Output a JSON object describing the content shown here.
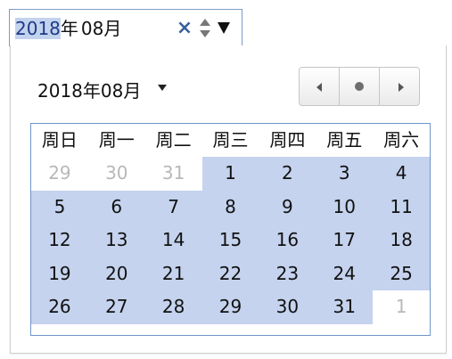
{
  "input": {
    "year": "2018",
    "year_suffix": "年",
    "month": "08",
    "month_suffix": "月",
    "clear_glyph": "×"
  },
  "picker": {
    "month_label": "2018年08月",
    "nav": {
      "prev_icon": "triangle-left-icon",
      "today_icon": "dot-icon",
      "next_icon": "triangle-right-icon"
    },
    "weekdays": [
      "周日",
      "周一",
      "周二",
      "周三",
      "周四",
      "周五",
      "周六"
    ],
    "weeks": [
      [
        {
          "d": "29",
          "other": true
        },
        {
          "d": "30",
          "other": true
        },
        {
          "d": "31",
          "other": true
        },
        {
          "d": "1"
        },
        {
          "d": "2"
        },
        {
          "d": "3"
        },
        {
          "d": "4"
        }
      ],
      [
        {
          "d": "5"
        },
        {
          "d": "6"
        },
        {
          "d": "7"
        },
        {
          "d": "8"
        },
        {
          "d": "9"
        },
        {
          "d": "10"
        },
        {
          "d": "11"
        }
      ],
      [
        {
          "d": "12"
        },
        {
          "d": "13"
        },
        {
          "d": "14"
        },
        {
          "d": "15"
        },
        {
          "d": "16"
        },
        {
          "d": "17"
        },
        {
          "d": "18"
        }
      ],
      [
        {
          "d": "19"
        },
        {
          "d": "20"
        },
        {
          "d": "21"
        },
        {
          "d": "22"
        },
        {
          "d": "23"
        },
        {
          "d": "24"
        },
        {
          "d": "25"
        }
      ],
      [
        {
          "d": "26"
        },
        {
          "d": "27"
        },
        {
          "d": "28"
        },
        {
          "d": "29"
        },
        {
          "d": "30"
        },
        {
          "d": "31"
        },
        {
          "d": "1",
          "other": true
        }
      ]
    ]
  },
  "colors": {
    "selected_month_bg": "#c5d3ee",
    "other_month_text": "#b8b8b8",
    "field_border": "#7a9cc7",
    "grid_border": "#6f95c9"
  }
}
